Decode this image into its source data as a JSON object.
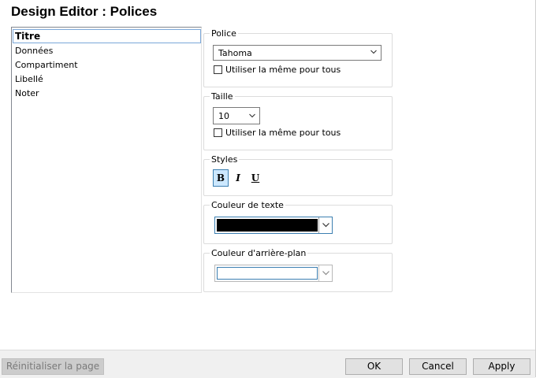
{
  "title": "Design Editor : Polices",
  "list": {
    "items": [
      "Titre",
      "Données",
      "Compartiment",
      "Libellé",
      "Noter"
    ],
    "selected_index": 0
  },
  "police": {
    "label": "Police",
    "value": "Tahoma",
    "same_for_all_label": "Utiliser la même pour tous",
    "same_for_all_checked": false
  },
  "taille": {
    "label": "Taille",
    "value": "10",
    "same_for_all_label": "Utiliser la même pour tous",
    "same_for_all_checked": false
  },
  "styles": {
    "label": "Styles",
    "bold": "B",
    "italic": "I",
    "underline": "U",
    "bold_active": true
  },
  "text_color": {
    "label": "Couleur de texte",
    "color": "#000000"
  },
  "bg_color": {
    "label": "Couleur d'arrière-plan",
    "color": "#ffffff"
  },
  "buttons": {
    "reset": "Réinitialiser la page",
    "ok": "OK",
    "cancel": "Cancel",
    "apply": "Apply"
  },
  "colors": {
    "selection_border": "#7aa7d8",
    "active_style_bg": "#cce8ff",
    "active_style_border": "#3c7fb1"
  }
}
